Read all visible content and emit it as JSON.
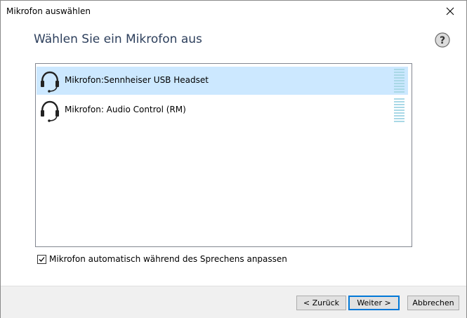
{
  "window": {
    "title": "Mikrofon auswählen",
    "close_symbol": "✕"
  },
  "header": {
    "heading": "Wählen Sie ein Mikrofon aus",
    "help_icon": "help-icon",
    "help_symbol": "?"
  },
  "microphones": [
    {
      "label": "Mikrofon:Sennheiser USB Headset",
      "icon": "headset-icon",
      "selected": true
    },
    {
      "label": "Mikrofon: Audio Control (RM)",
      "icon": "headset-icon",
      "selected": false
    }
  ],
  "options": {
    "auto_adjust_label": "Mikrofon automatisch während des Sprechens anpassen",
    "auto_adjust_checked": true
  },
  "buttons": {
    "back_label": "< Zurück",
    "next_label": "Weiter >",
    "cancel_label": "Abbrechen"
  },
  "colors": {
    "selection": "#cce8ff",
    "heading": "#2d3f5c",
    "level_meter": "#a9d8e6",
    "default_button_border": "#0078d7"
  }
}
